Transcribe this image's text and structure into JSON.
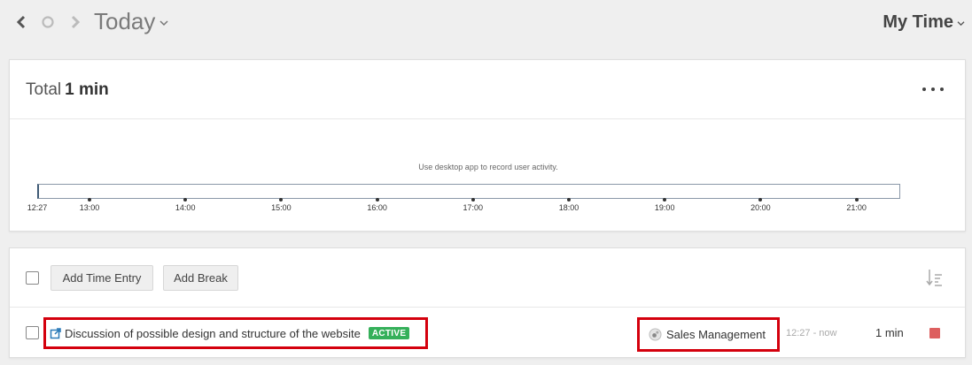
{
  "nav": {
    "date_title": "Today",
    "view_title": "My Time"
  },
  "total": {
    "label": "Total",
    "value": "1 min"
  },
  "timeline": {
    "hint": "Use desktop app to record user activity.",
    "ticks": [
      "12:27",
      "13:00",
      "14:00",
      "15:00",
      "16:00",
      "17:00",
      "18:00",
      "19:00",
      "20:00",
      "21:00"
    ]
  },
  "toolbar": {
    "add_time_entry": "Add Time Entry",
    "add_break": "Add Break"
  },
  "entries": [
    {
      "name": "Discussion of possible design and structure of the website",
      "badge": "ACTIVE",
      "project": "Sales Management",
      "time_range": "12:27 - now",
      "duration": "1 min"
    }
  ],
  "colors": {
    "highlight": "#d4000d",
    "active_badge": "#35b05a",
    "stop": "#dd5f5f",
    "edit_icon": "#2a7ab8"
  },
  "icons": {
    "prev": "chevron-left-icon",
    "home": "circle-icon",
    "next": "chevron-right-icon",
    "more": "more-horizontal-icon",
    "sort": "sort-icon",
    "edit": "external-edit-icon",
    "project": "project-icon",
    "stop": "stop-icon"
  }
}
